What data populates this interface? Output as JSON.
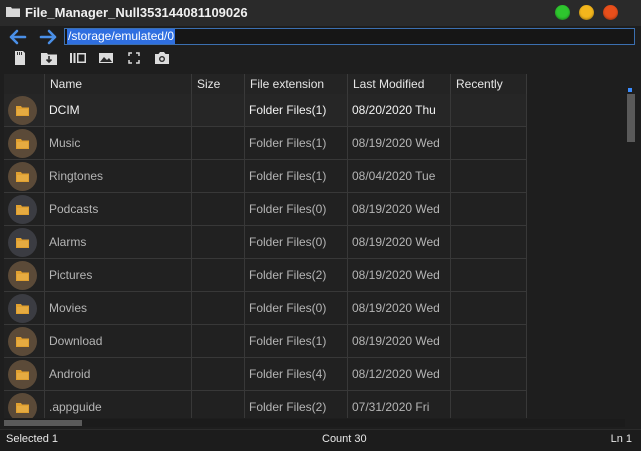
{
  "window": {
    "title": "File_Manager_Null353144081109026"
  },
  "address_bar": {
    "path": "/storage/emulated/0"
  },
  "toolbar_icons": [
    "sd-card-icon",
    "folder-download-icon",
    "columns-view-icon",
    "image-view-icon",
    "fullscreen-icon",
    "camera-icon"
  ],
  "table": {
    "columns": [
      "Name",
      "Size",
      "File extension",
      "Last Modified",
      "Recently"
    ],
    "rows": [
      {
        "name": "DCIM",
        "size": "",
        "ext": "Folder Files(1)",
        "modified": "08/20/2020 Thu",
        "recently": "",
        "tone": "warm"
      },
      {
        "name": "Music",
        "size": "",
        "ext": "Folder Files(1)",
        "modified": "08/19/2020 Wed",
        "recently": "",
        "tone": "warm"
      },
      {
        "name": "Ringtones",
        "size": "",
        "ext": "Folder Files(1)",
        "modified": "08/04/2020 Tue",
        "recently": "",
        "tone": "warm"
      },
      {
        "name": "Podcasts",
        "size": "",
        "ext": "Folder Files(0)",
        "modified": "08/19/2020 Wed",
        "recently": "",
        "tone": "cool"
      },
      {
        "name": "Alarms",
        "size": "",
        "ext": "Folder Files(0)",
        "modified": "08/19/2020 Wed",
        "recently": "",
        "tone": "cool"
      },
      {
        "name": "Pictures",
        "size": "",
        "ext": "Folder Files(2)",
        "modified": "08/19/2020 Wed",
        "recently": "",
        "tone": "warm"
      },
      {
        "name": "Movies",
        "size": "",
        "ext": "Folder Files(0)",
        "modified": "08/19/2020 Wed",
        "recently": "",
        "tone": "cool"
      },
      {
        "name": "Download",
        "size": "",
        "ext": "Folder Files(1)",
        "modified": "08/19/2020 Wed",
        "recently": "",
        "tone": "warm"
      },
      {
        "name": "Android",
        "size": "",
        "ext": "Folder Files(4)",
        "modified": "08/12/2020 Wed",
        "recently": "",
        "tone": "warm"
      },
      {
        "name": ".appguide",
        "size": "",
        "ext": "Folder Files(2)",
        "modified": "07/31/2020 Fri",
        "recently": "",
        "tone": "warm"
      }
    ]
  },
  "status": {
    "selected": "Selected 1",
    "count": "Count 30",
    "line": "Ln 1"
  },
  "colors": {
    "background": "#1e1e1e",
    "accent": "#2f6fe0",
    "folder": "#e0a030",
    "close": "#e84f1b",
    "minimize": "#2ec52e",
    "maximize": "#f3b61c"
  }
}
